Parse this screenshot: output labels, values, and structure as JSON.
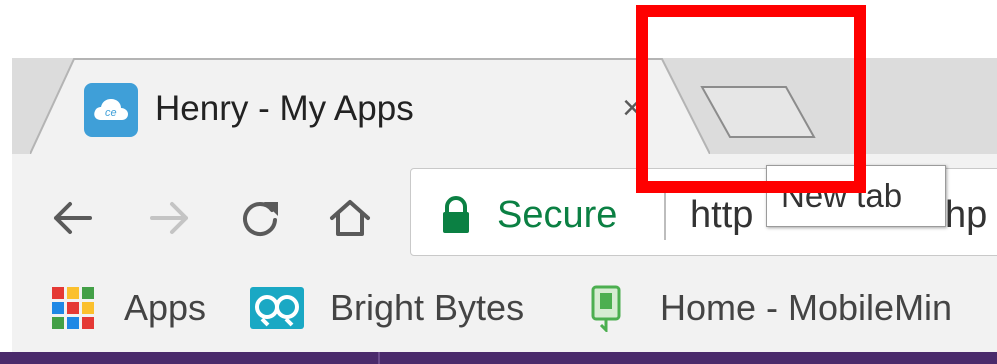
{
  "tab": {
    "title": "Henry - My Apps",
    "close_glyph": "×",
    "favicon": "cloud-icon"
  },
  "new_tab": {
    "tooltip": "New tab",
    "icon": "new-tab-icon"
  },
  "toolbar": {
    "back_icon": "back-arrow-icon",
    "forward_icon": "forward-arrow-icon",
    "reload_icon": "reload-icon",
    "home_icon": "home-icon"
  },
  "omnibox": {
    "secure_label": "Secure",
    "url_visible_start": "http",
    "url_visible_tail": "hp",
    "lock_icon": "lock-icon"
  },
  "bookmarks": {
    "items": [
      {
        "label": "Apps",
        "icon": "apps-grid-icon"
      },
      {
        "label": "Bright Bytes",
        "icon": "bright-bytes-icon"
      },
      {
        "label": "Home - MobileMin",
        "icon": "bookmark-book-icon"
      }
    ]
  },
  "colors": {
    "highlight": "#ff0000",
    "secure_green": "#0b8043",
    "favicon_blue": "#3f9fd8",
    "bright_bytes_teal": "#1aa8c4",
    "bottom_purple": "#4a2a6b"
  }
}
